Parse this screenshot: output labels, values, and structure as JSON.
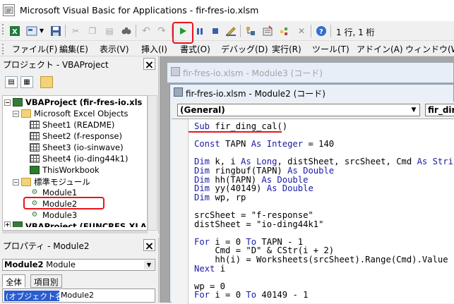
{
  "window": {
    "title": "Microsoft Visual Basic for Applications - fir-fres-io.xlsm"
  },
  "toolbar": {
    "cursor_position": "1 行, 1 桁",
    "icons": [
      "excel-icon",
      "insert-userform-icon",
      "save-icon",
      "cut-icon",
      "copy-icon",
      "paste-icon",
      "find-icon",
      "undo-icon",
      "redo-icon",
      "run-icon",
      "break-icon",
      "reset-icon",
      "design-mode-icon",
      "project-explorer-icon",
      "properties-icon",
      "object-browser-icon",
      "toolbox-icon",
      "help-icon"
    ]
  },
  "menubar": {
    "items": [
      "ファイル(F)",
      "編集(E)",
      "表示(V)",
      "挿入(I)",
      "書式(O)",
      "デバッグ(D)",
      "実行(R)",
      "ツール(T)",
      "アドイン(A)",
      "ウィンドウ(W"
    ]
  },
  "project": {
    "title": "プロジェクト - VBAProject",
    "root": "VBAProject (fir-fres-io.xls",
    "excel_objects_folder": "Microsoft Excel Objects",
    "sheets": [
      "Sheet1 (README)",
      "Sheet2 (f-response)",
      "Sheet3 (io-sinwave)",
      "Sheet4 (io-ding44k1)",
      "ThisWorkbook"
    ],
    "modules_folder": "標準モジュール",
    "modules": [
      "Module1",
      "Module2",
      "Module3"
    ],
    "partial_row": "VBAProject (FUNCRES.XLAM)"
  },
  "properties": {
    "title": "プロパティ - Module2",
    "object_name": "Module2",
    "object_type": "Module",
    "tabs": [
      "全体",
      "項目別"
    ],
    "row_name": "(オブジェクト名)",
    "row_value": "Module2"
  },
  "bg_window": {
    "title": "fir-fres-io.xlsm - Module3 (コード)"
  },
  "code_window": {
    "title": "fir-fres-io.xlsm - Module2 (コード)",
    "object_combo": "(General)",
    "proc_combo": "fir_ding",
    "lines": [
      "Sub fir_ding_cal()",
      "",
      "Const TAPN As Integer = 140",
      "",
      "Dim k, i As Long, distSheet, srcSheet, Cmd As String",
      "Dim ringbuf(TAPN) As Double",
      "Dim hh(TAPN) As Double",
      "Dim yy(40149) As Double",
      "Dim wp, rp",
      "",
      "srcSheet = \"f-response\"",
      "distSheet = \"io-ding44k1\"",
      "",
      "For i = 0 To TAPN - 1",
      "    Cmd = \"D\" & CStr(i + 2)",
      "    hh(i) = Worksheets(srcSheet).Range(Cmd).Value",
      "Next i",
      "",
      "wp = 0",
      "For i = 0 To 40149 - 1"
    ]
  },
  "colors": {
    "highlight": "#e8161b",
    "selection": "#2a5ccf",
    "run": "#1e9b2f"
  }
}
